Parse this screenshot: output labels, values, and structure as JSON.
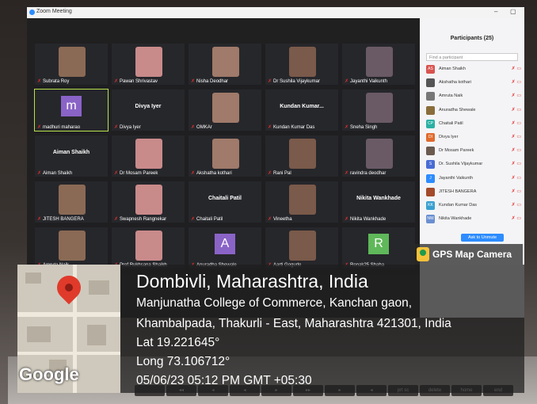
{
  "zoom": {
    "window_title": "Zoom Meeting",
    "min": "–",
    "restore": "▢",
    "participants_title": "Participants (25)",
    "search_placeholder": "Find a participant",
    "ask_to_unmute": "Ask to Unmute"
  },
  "tiles": [
    {
      "name": "Subrata Roy"
    },
    {
      "name": "Pawan Shrivastav"
    },
    {
      "name": "Nisha Deodhar"
    },
    {
      "name": "Dr Sushila Vijaykumar"
    },
    {
      "name": "Jayanthi Vaikunth"
    },
    {
      "name": "madhuri maharao",
      "avatar": "m"
    },
    {
      "name": "Divya Iyer",
      "big": "Divya Iyer"
    },
    {
      "name": "OMKAr"
    },
    {
      "name": "Kundan Kumar Das",
      "big": "Kundan Kumar..."
    },
    {
      "name": "Sneha Singh"
    },
    {
      "name": "Aiman Shaikh",
      "big": "Aiman Shaikh"
    },
    {
      "name": "Dr Mosam Pareek"
    },
    {
      "name": "Akshatha kothari"
    },
    {
      "name": "Rani Pal"
    },
    {
      "name": "ravindra deodhar"
    },
    {
      "name": "JITESH BANGERA"
    },
    {
      "name": "Swapnesh Rangnekar"
    },
    {
      "name": "Chaitali Patil",
      "big": "Chaitali Patil"
    },
    {
      "name": "Vineetha"
    },
    {
      "name": "Nikita Wankhade",
      "big": "Nikita Wankhade"
    },
    {
      "name": "Amruta Naik"
    },
    {
      "name": "Prof.Rukhsana Shaikh"
    },
    {
      "name": "Anuradha Shewale",
      "avatar": "A"
    },
    {
      "name": "Aarti Gogurle"
    },
    {
      "name": "Ronak25 Shaha",
      "avatar": "R"
    }
  ],
  "participants": [
    {
      "initials": "AS",
      "name": "Aiman Shaikh",
      "color": "#d9534f"
    },
    {
      "initials": "",
      "name": "Akshatha kothari",
      "color": "#555"
    },
    {
      "initials": "",
      "name": "Amruta Naik",
      "color": "#777"
    },
    {
      "initials": "",
      "name": "Anuradha Shewale",
      "color": "#8a6d3b"
    },
    {
      "initials": "CP",
      "name": "Chaitali Patil",
      "color": "#2bb0a3"
    },
    {
      "initials": "DI",
      "name": "Divya Iyer",
      "color": "#e06b2e"
    },
    {
      "initials": "",
      "name": "Dr Mosam Pareek",
      "color": "#6b5a4e"
    },
    {
      "initials": "S",
      "name": "Dr. Sushila Vijaykumar",
      "color": "#4a6cd4"
    },
    {
      "initials": "J",
      "name": "Jayanthi Vaikunth",
      "color": "#2d8cff"
    },
    {
      "initials": "",
      "name": "JITESH BANGERA",
      "color": "#a34a2a"
    },
    {
      "initials": "KK",
      "name": "Kundan Kumar Das",
      "color": "#39a0d0"
    },
    {
      "initials": "NW",
      "name": "Nikita Wankhade",
      "color": "#6a8fd1"
    }
  ],
  "gps": {
    "app_label": "GPS Map Camera",
    "place": "Dombivli, Maharashtra, India",
    "address_line1": "Manjunatha College of Commerce, Kanchan gaon,",
    "address_line2": "Khambalpada, Thakurli - East, Maharashtra 421301, India",
    "lat": "Lat 19.221645°",
    "long": "Long 73.106712°",
    "datetime": "05/06/23 05:12 PM GMT +05:30",
    "map_brand": "Google"
  },
  "keys": [
    "",
    "◂◂",
    "◂",
    "◂",
    "▸",
    "▸▸",
    "▸",
    "◂",
    "prt sc",
    "delete",
    "home",
    "end"
  ]
}
